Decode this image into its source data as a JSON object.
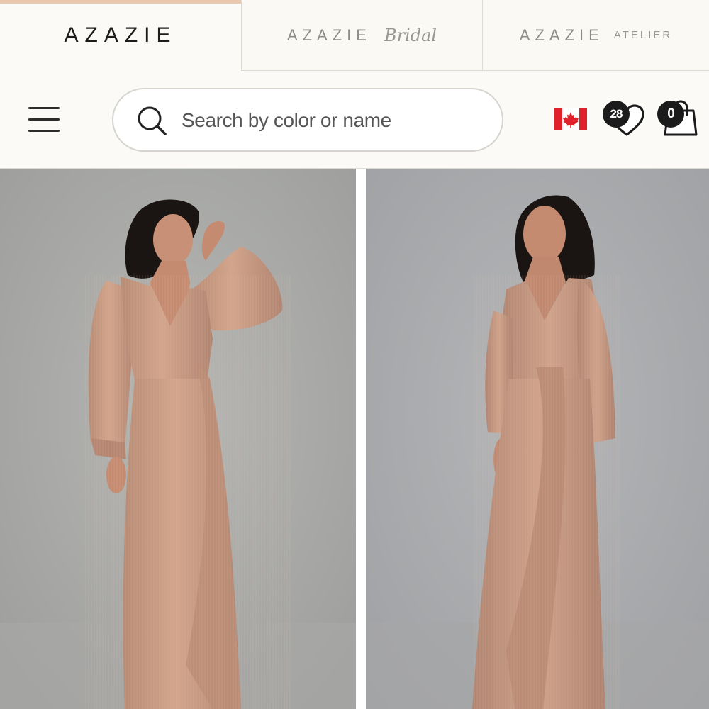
{
  "brand_tabs": [
    {
      "name": "AZAZIE",
      "suffix": "",
      "active": true
    },
    {
      "name": "AZAZIE",
      "suffix": "Bridal",
      "active": false
    },
    {
      "name": "AZAZIE",
      "suffix": "ATELIER",
      "active": false
    }
  ],
  "header": {
    "menu_icon": "hamburger-menu-icon",
    "search": {
      "placeholder": "Search by color or name",
      "value": "",
      "icon": "search-icon"
    },
    "region_flag": "canada-flag-icon",
    "wishlist": {
      "icon": "heart-icon",
      "count": "28"
    },
    "cart": {
      "icon": "shopping-bag-icon",
      "count": "0"
    }
  },
  "colors": {
    "accent_bar": "#e9c8ad",
    "header_bg": "#fbfaf6",
    "dress": "#c99a82",
    "backdrop": "#a9aaa9"
  }
}
